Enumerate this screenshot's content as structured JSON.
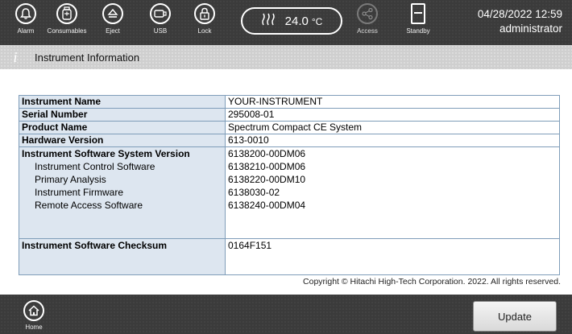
{
  "topbar": {
    "alarm_label": "Alarm",
    "consumables_label": "Consumables",
    "eject_label": "Eject",
    "usb_label": "USB",
    "lock_label": "Lock",
    "temperature_value": "24.0",
    "temperature_unit": "°C",
    "access_label": "Access",
    "standby_label": "Standby",
    "datetime": "04/28/2022 12:59",
    "user": "administrator"
  },
  "subheader": {
    "icon": "info-icon",
    "title": "Instrument Information"
  },
  "table": {
    "rows": [
      {
        "label": "Instrument Name",
        "value": "YOUR-INSTRUMENT"
      },
      {
        "label": "Serial Number",
        "value": "295008-01"
      },
      {
        "label": "Product Name",
        "value": "Spectrum Compact CE System"
      },
      {
        "label": "Hardware Version",
        "value": "613-0010"
      }
    ],
    "software": {
      "label": "Instrument Software System Version",
      "value": "6138200-00DM06",
      "items": [
        {
          "label": "Instrument Control Software",
          "value": "6138210-00DM06"
        },
        {
          "label": "Primary Analysis",
          "value": "6138220-00DM10"
        },
        {
          "label": "Instrument Firmware",
          "value": "6138030-02"
        },
        {
          "label": "Remote Access Software",
          "value": "6138240-00DM04"
        }
      ]
    },
    "checksum": {
      "label": "Instrument Software Checksum",
      "value": "0164F151"
    }
  },
  "footer": {
    "copyright": "Copyright © Hitachi High-Tech Corporation. 2022. All rights reserved."
  },
  "bottombar": {
    "home_label": "Home",
    "update_label": "Update"
  },
  "colors": {
    "bar_background": "#3b3b3b",
    "subheader_background": "#cfcfcf",
    "label_cell_background": "#dde6f0",
    "table_border": "#7f9db9"
  }
}
